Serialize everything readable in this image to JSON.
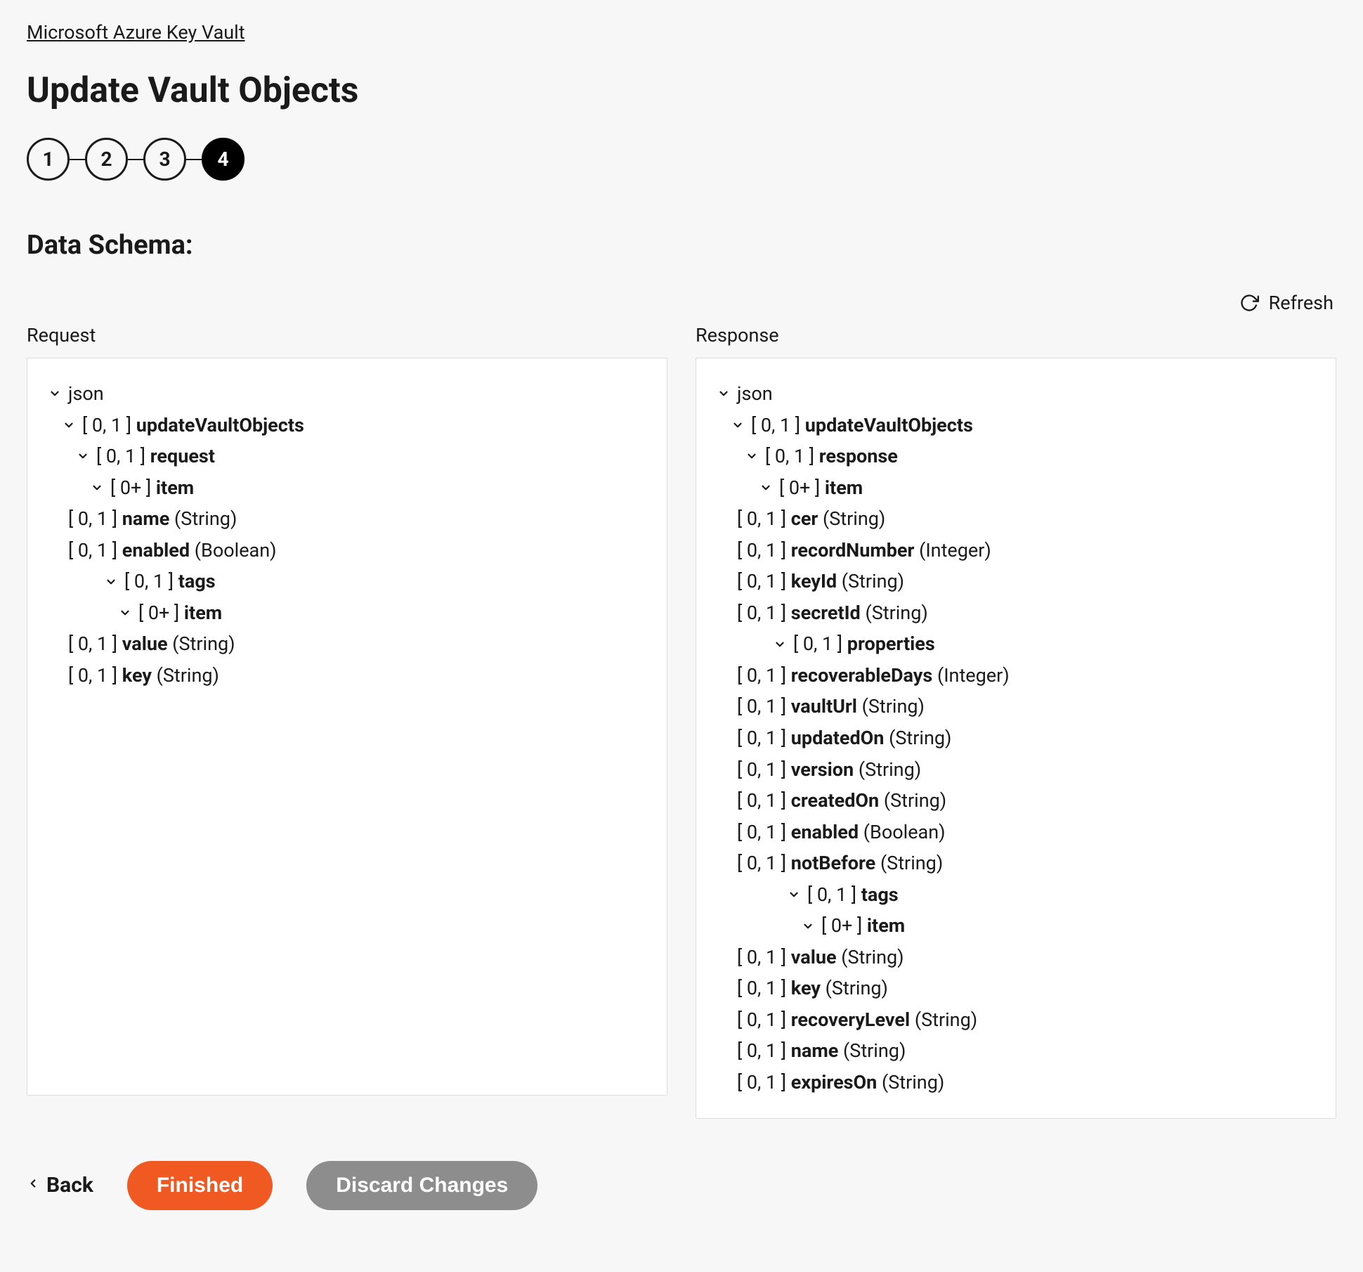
{
  "breadcrumb": {
    "label": "Microsoft Azure Key Vault"
  },
  "page": {
    "title": "Update Vault Objects"
  },
  "stepper": {
    "steps": [
      "1",
      "2",
      "3",
      "4"
    ],
    "active_index": 3
  },
  "section": {
    "heading": "Data Schema:"
  },
  "refresh": {
    "label": "Refresh"
  },
  "panels": {
    "request": {
      "label": "Request",
      "root": "json",
      "tree": [
        {
          "indent": 0,
          "chev": true,
          "card": null,
          "name": "json",
          "type": null
        },
        {
          "indent": 1,
          "chev": true,
          "card": "[ 0, 1 ]",
          "name": "updateVaultObjects",
          "type": null
        },
        {
          "indent": 2,
          "chev": true,
          "card": "[ 0, 1 ]",
          "name": "request",
          "type": null
        },
        {
          "indent": 3,
          "chev": true,
          "card": "[ 0+ ]",
          "name": "item",
          "type": null
        },
        {
          "indent": 4,
          "chev": false,
          "card": "[ 0, 1 ]",
          "name": "name",
          "type": "(String)"
        },
        {
          "indent": 4,
          "chev": false,
          "card": "[ 0, 1 ]",
          "name": "enabled",
          "type": "(Boolean)"
        },
        {
          "indent": 4,
          "chev": true,
          "card": "[ 0, 1 ]",
          "name": "tags",
          "type": null
        },
        {
          "indent": 5,
          "chev": true,
          "card": "[ 0+ ]",
          "name": "item",
          "type": null
        },
        {
          "indent": 6,
          "chev": false,
          "card": "[ 0, 1 ]",
          "name": "value",
          "type": "(String)"
        },
        {
          "indent": 6,
          "chev": false,
          "card": "[ 0, 1 ]",
          "name": "key",
          "type": "(String)"
        }
      ]
    },
    "response": {
      "label": "Response",
      "root": "json",
      "tree": [
        {
          "indent": 0,
          "chev": true,
          "card": null,
          "name": "json",
          "type": null
        },
        {
          "indent": 1,
          "chev": true,
          "card": "[ 0, 1 ]",
          "name": "updateVaultObjects",
          "type": null
        },
        {
          "indent": 2,
          "chev": true,
          "card": "[ 0, 1 ]",
          "name": "response",
          "type": null
        },
        {
          "indent": 3,
          "chev": true,
          "card": "[ 0+ ]",
          "name": "item",
          "type": null
        },
        {
          "indent": 4,
          "chev": false,
          "card": "[ 0, 1 ]",
          "name": "cer",
          "type": "(String)"
        },
        {
          "indent": 4,
          "chev": false,
          "card": "[ 0, 1 ]",
          "name": "recordNumber",
          "type": "(Integer)"
        },
        {
          "indent": 4,
          "chev": false,
          "card": "[ 0, 1 ]",
          "name": "keyId",
          "type": "(String)"
        },
        {
          "indent": 4,
          "chev": false,
          "card": "[ 0, 1 ]",
          "name": "secretId",
          "type": "(String)"
        },
        {
          "indent": 4,
          "chev": true,
          "card": "[ 0, 1 ]",
          "name": "properties",
          "type": null
        },
        {
          "indent": 5,
          "chev": false,
          "card": "[ 0, 1 ]",
          "name": "recoverableDays",
          "type": "(Integer)"
        },
        {
          "indent": 5,
          "chev": false,
          "card": "[ 0, 1 ]",
          "name": "vaultUrl",
          "type": "(String)"
        },
        {
          "indent": 5,
          "chev": false,
          "card": "[ 0, 1 ]",
          "name": "updatedOn",
          "type": "(String)"
        },
        {
          "indent": 5,
          "chev": false,
          "card": "[ 0, 1 ]",
          "name": "version",
          "type": "(String)"
        },
        {
          "indent": 5,
          "chev": false,
          "card": "[ 0, 1 ]",
          "name": "createdOn",
          "type": "(String)"
        },
        {
          "indent": 5,
          "chev": false,
          "card": "[ 0, 1 ]",
          "name": "enabled",
          "type": "(Boolean)"
        },
        {
          "indent": 5,
          "chev": false,
          "card": "[ 0, 1 ]",
          "name": "notBefore",
          "type": "(String)"
        },
        {
          "indent": 5,
          "chev": true,
          "card": "[ 0, 1 ]",
          "name": "tags",
          "type": null
        },
        {
          "indent": 6,
          "chev": true,
          "card": "[ 0+ ]",
          "name": "item",
          "type": null
        },
        {
          "indent": 7,
          "chev": false,
          "card": "[ 0, 1 ]",
          "name": "value",
          "type": "(String)"
        },
        {
          "indent": 7,
          "chev": false,
          "card": "[ 0, 1 ]",
          "name": "key",
          "type": "(String)"
        },
        {
          "indent": 5,
          "chev": false,
          "card": "[ 0, 1 ]",
          "name": "recoveryLevel",
          "type": "(String)"
        },
        {
          "indent": 5,
          "chev": false,
          "card": "[ 0, 1 ]",
          "name": "name",
          "type": "(String)"
        },
        {
          "indent": 5,
          "chev": false,
          "card": "[ 0, 1 ]",
          "name": "expiresOn",
          "type": "(String)"
        }
      ]
    }
  },
  "footer": {
    "back": "Back",
    "finished": "Finished",
    "discard": "Discard Changes"
  }
}
